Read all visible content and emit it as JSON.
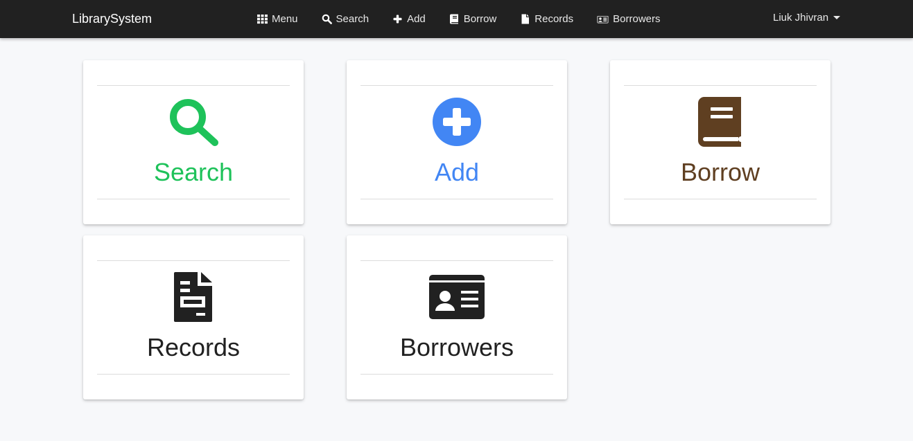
{
  "navbar": {
    "brand": "LibrarySystem",
    "items": [
      {
        "label": "Menu",
        "icon": "grid-icon"
      },
      {
        "label": "Search",
        "icon": "search-icon"
      },
      {
        "label": "Add",
        "icon": "plus-icon"
      },
      {
        "label": "Borrow",
        "icon": "book-icon"
      },
      {
        "label": "Records",
        "icon": "file-icon"
      },
      {
        "label": "Borrowers",
        "icon": "id-card-icon"
      }
    ],
    "user": "Liuk Jhivran"
  },
  "cards": [
    {
      "label": "Search",
      "icon": "search-icon",
      "color": "#1ec25a"
    },
    {
      "label": "Add",
      "icon": "plus-circle-icon",
      "color": "#4286f4"
    },
    {
      "label": "Borrow",
      "icon": "book-icon",
      "color": "#5f3f21"
    },
    {
      "label": "Records",
      "icon": "file-alt-icon",
      "color": "#212121"
    },
    {
      "label": "Borrowers",
      "icon": "id-card-icon",
      "color": "#212121"
    }
  ]
}
